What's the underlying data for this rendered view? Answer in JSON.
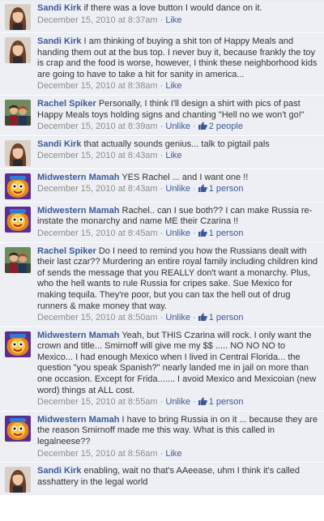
{
  "comments": [
    {
      "author": "Sandi Kirk",
      "avatar": "woman-brown-hair",
      "text": "if there was a love button I would dance on it.",
      "time": "December 15, 2010 at 8:37am",
      "action": "Like",
      "likes": ""
    },
    {
      "author": "Sandi Kirk",
      "avatar": "woman-brown-hair",
      "text": "I am thinking of buying a shit ton of Happy Meals and handing them out at the bus top. I never buy it, because frankly the toy is crap and the food is worse, however, I think these neighborhood kids are going to have to take a hit for sanity in america...",
      "time": "December 15, 2010 at 8:38am",
      "action": "Like",
      "likes": ""
    },
    {
      "author": "Rachel Spiker",
      "avatar": "couple-photo",
      "text": "Personally, I think I'll design a shirt with pics of past Happy Meals toys holding signs and chanting \"Hell no we won't go!\"",
      "time": "December 15, 2010 at 8:39am",
      "action": "Unlike",
      "likes": "2 people"
    },
    {
      "author": "Sandi Kirk",
      "avatar": "woman-brown-hair",
      "text": "that actually sounds genius... talk to pigtail pals",
      "time": "December 15, 2010 at 8:43am",
      "action": "Like",
      "likes": ""
    },
    {
      "author": "Midwestern Mamah",
      "avatar": "cartoon-face",
      "text": "YES Rachel ... and I want one !!",
      "time": "December 15, 2010 at 8:43am",
      "action": "Unlike",
      "likes": "1 person"
    },
    {
      "author": "Midwestern Mamah",
      "avatar": "cartoon-face",
      "text": "Rachel.. can I sue both?? I can make Russia re-instate the monarchy and name ME their Czarina !!",
      "time": "December 15, 2010 at 8:45am",
      "action": "Unlike",
      "likes": "1 person"
    },
    {
      "author": "Rachel Spiker",
      "avatar": "couple-photo",
      "text": "Do I need to remind you how the Russians dealt with their last czar?? Murdering an entire royal family including children kind of sends the message that you REALLY don't want a monarchy. Plus, who the hell wants to rule Russia for cripes sake. Sue Mexico for making tequila. They're poor, but you can tax the hell out of drug runners & make money that way.",
      "time": "December 15, 2010 at 8:50am",
      "action": "Unlike",
      "likes": "1 person"
    },
    {
      "author": "Midwestern Mamah",
      "avatar": "cartoon-face",
      "text": "Yeah, but THIS Czarina will rock. I only want the crown and title... Smirnoff will give me my $$ ..... NO NO NO to Mexico... I had enough Mexico when I lived in Central Florida... the question \"you speak Spanish?\" nearly landed me in jail on more than one occasion. Except for Frida....... I avoid Mexico and Mexicoian (new word) things at ALL cost.",
      "time": "December 15, 2010 at 8:55am",
      "action": "Unlike",
      "likes": "1 person"
    },
    {
      "author": "Midwestern Mamah",
      "avatar": "cartoon-face",
      "text": "I have to bring Russia in on it ... because they are the reason Smirnoff made me this way. What is this called in legalneese??",
      "time": "December 15, 2010 at 8:56am",
      "action": "Like",
      "likes": ""
    },
    {
      "author": "Sandi Kirk",
      "avatar": "woman-brown-hair",
      "text": "enabling, wait no that's AAeease, uhm I think it's called asshattery in the legal world",
      "time": "",
      "action": "",
      "likes": ""
    }
  ],
  "separator": " · ",
  "thumb_icon": "thumbs-up-icon"
}
